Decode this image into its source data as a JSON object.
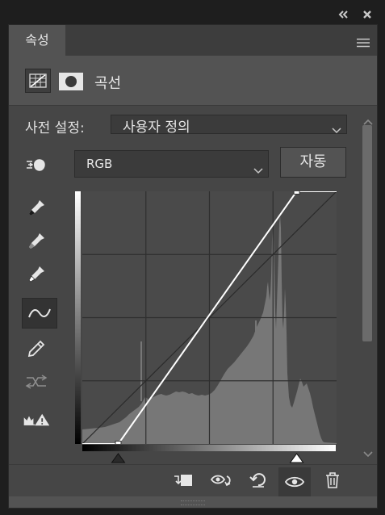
{
  "panel": {
    "tab_label": "속성",
    "adjustment_title": "곡선"
  },
  "preset": {
    "label": "사전 설정:",
    "value": "사용자 정의"
  },
  "channel": {
    "value": "RGB"
  },
  "auto_button": "자동",
  "curve": {
    "input_range": [
      0,
      255
    ],
    "output_range": [
      0,
      255
    ],
    "points": [
      [
        36,
        0
      ],
      [
        215,
        255
      ]
    ],
    "grid": "4x4"
  },
  "colors": {
    "panel_bg": "#535353",
    "graph_bg": "#4a4a4a",
    "histogram": "#777777",
    "curve_line": "#ffffff"
  },
  "icons": {
    "window_collapse": "double-chevron-left-icon",
    "window_close": "close-icon",
    "panel_menu": "hamburger-menu-icon",
    "adjustment_layer": "curves-layer-icon",
    "mask": "mask-icon",
    "on_image_tool": "hand-target-icon",
    "sample_black": "black-eyedropper-icon",
    "sample_gray": "gray-eyedropper-icon",
    "sample_white": "white-eyedropper-icon",
    "edit_curve": "curve-points-icon",
    "draw_curve": "pencil-icon",
    "smooth_curve": "smooth-icon",
    "clipping_warning": "clipping-warning-icon",
    "clip_to_layer": "clip-to-layer-icon",
    "view_previous": "view-previous-icon",
    "reset": "reset-icon",
    "visibility": "eye-icon",
    "delete": "trash-icon"
  }
}
